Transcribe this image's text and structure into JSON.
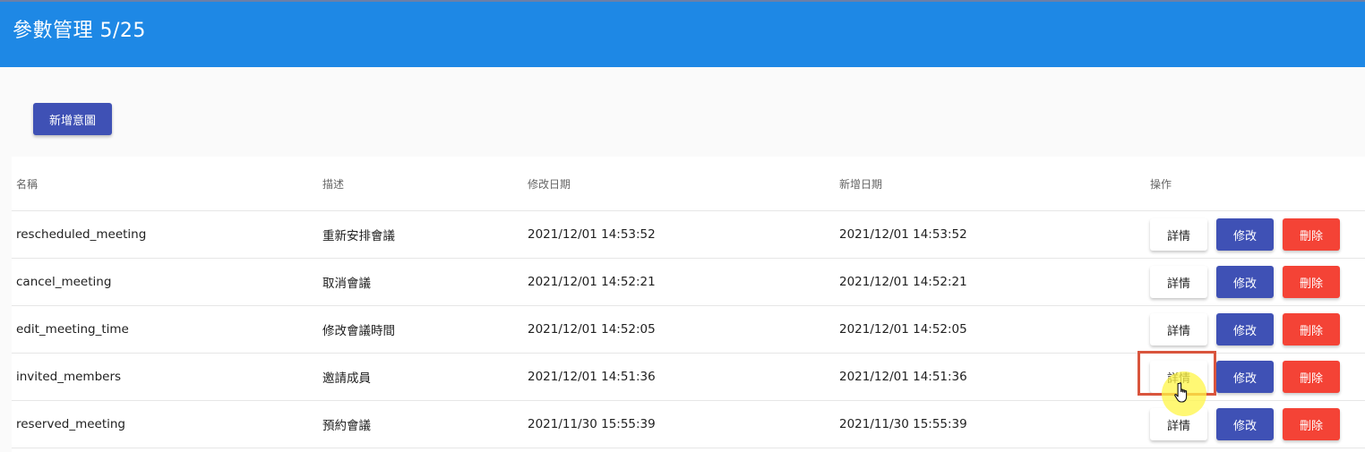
{
  "header": {
    "title": "參數管理 5/25"
  },
  "toolbar": {
    "add_label": "新增意圖"
  },
  "table": {
    "columns": {
      "name": "名稱",
      "description": "描述",
      "modified": "修改日期",
      "created": "新增日期",
      "actions": "操作"
    },
    "actions": {
      "detail": "詳情",
      "edit": "修改",
      "delete": "刪除"
    },
    "rows": [
      {
        "name": "rescheduled_meeting",
        "description": "重新安排會議",
        "modified": "2021/12/01 14:53:52",
        "created": "2021/12/01 14:53:52"
      },
      {
        "name": "cancel_meeting",
        "description": "取消會議",
        "modified": "2021/12/01 14:52:21",
        "created": "2021/12/01 14:52:21"
      },
      {
        "name": "edit_meeting_time",
        "description": "修改會議時間",
        "modified": "2021/12/01 14:52:05",
        "created": "2021/12/01 14:52:05"
      },
      {
        "name": "invited_members",
        "description": "邀請成員",
        "modified": "2021/12/01 14:51:36",
        "created": "2021/12/01 14:51:36"
      },
      {
        "name": "reserved_meeting",
        "description": "預約會議",
        "modified": "2021/11/30 15:55:39",
        "created": "2021/11/30 15:55:39"
      }
    ]
  },
  "colors": {
    "header": "#1e88e5",
    "primary": "#3f51b5",
    "danger": "#f44336",
    "highlight": "#d9553d"
  },
  "icons": {
    "cursor": "hand-pointer-icon"
  }
}
